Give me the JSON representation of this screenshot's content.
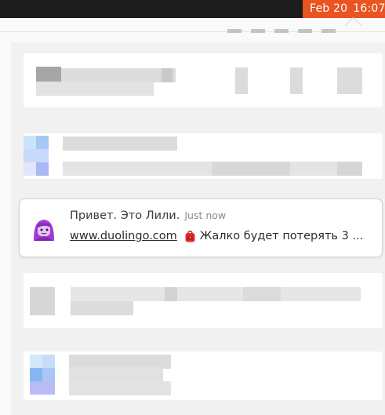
{
  "topbar": {
    "date": "Feb 20",
    "time": "16:07",
    "accent": "#e95420",
    "background": "#1d1d1d"
  },
  "notification": {
    "title": "Привет. Это Лили.",
    "time": "Just now",
    "link": "www.duolingo.com",
    "message": "Жалко будет потерять 3 ...",
    "icon": "lily-avatar-icon",
    "body_icon": "red-backpack-icon"
  }
}
